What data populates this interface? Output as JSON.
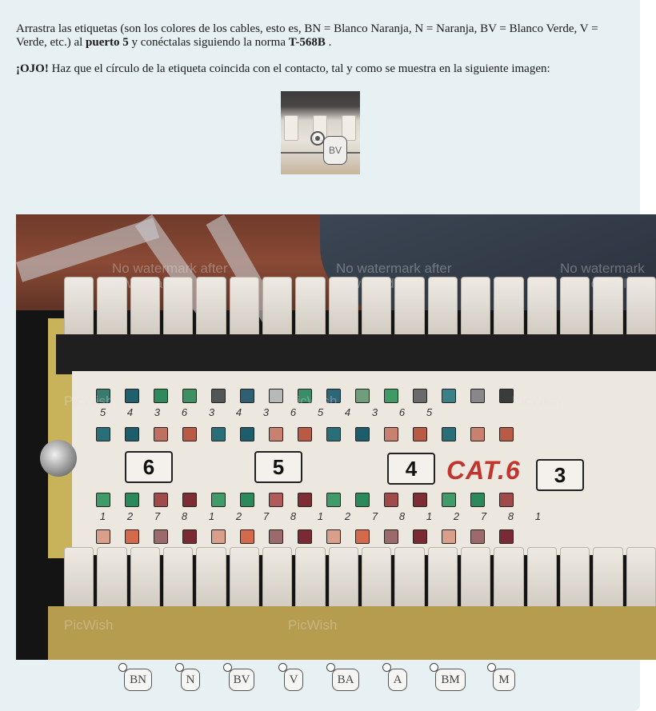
{
  "instructions": {
    "p1_a": "Arrastra las etiquetas (son los colores de los cables, esto es, BN = Blanco Naranja, N = Naranja, BV = Blanco Verde, V = Verde, etc.) al ",
    "p1_port": "puerto 5",
    "p1_b": " y conéctalas siguiendo la norma ",
    "p1_norm": "T-568B",
    "p1_c": " .",
    "p2_warn": "¡OJO!",
    "p2_text": " Haz que el círculo de la etiqueta coincida con el contacto, tal y como se muestra en la siguiente imagen:"
  },
  "example": {
    "label": "BV"
  },
  "photo": {
    "ports": [
      "6",
      "5",
      "4",
      "3"
    ],
    "category": "CAT.6",
    "top_digits": [
      "5",
      "4",
      "3",
      "6",
      "3",
      "4",
      "3",
      "6",
      "5",
      "4",
      "3",
      "6",
      "5"
    ],
    "bottom_digits": [
      "1",
      "2",
      "7",
      "8",
      "1",
      "2",
      "7",
      "8",
      "1",
      "2",
      "7",
      "8",
      "1",
      "2",
      "7",
      "8",
      "1"
    ],
    "watermarks": [
      "No watermark after download",
      "No watermark after download",
      "No watermark after download",
      "PicWish",
      "PicWish",
      "PicWish",
      "PicWish",
      "PicWish"
    ]
  },
  "labels": [
    "BN",
    "N",
    "BV",
    "V",
    "BA",
    "A",
    "BM",
    "M"
  ],
  "colors": {
    "panel_bg": "#e7f1f3",
    "cat_red": "#c0352e"
  }
}
